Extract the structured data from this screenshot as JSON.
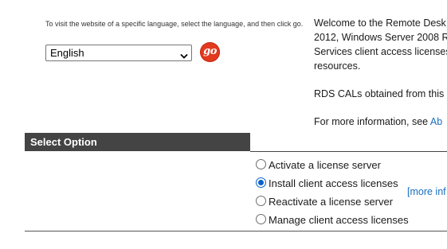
{
  "language": {
    "instructions": "To visit the website of a specific language, select the language, and then click go.",
    "selected": "English",
    "go_label": "go",
    "go_color": "#e2391f"
  },
  "welcome": {
    "lines": [
      "Welcome to the Remote Desk",
      "2012, Windows Server 2008 R",
      "Services client access licenses",
      "resources."
    ],
    "rds_text": "RDS CALs obtained from this",
    "more_prefix": "For more information, see ",
    "more_link": "Ab"
  },
  "select_option": {
    "header": "Select Option",
    "options": [
      {
        "label": "Activate a license server",
        "checked": false
      },
      {
        "label": "Install client access licenses",
        "checked": true
      },
      {
        "label": "Reactivate a license server",
        "checked": false
      },
      {
        "label": "Manage client access licenses",
        "checked": false
      }
    ],
    "more_info": "[more inf"
  }
}
